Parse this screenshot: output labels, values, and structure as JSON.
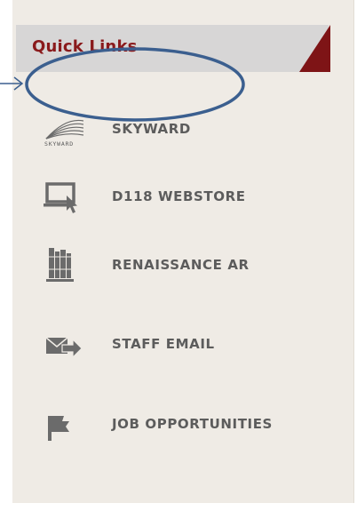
{
  "quick_links": {
    "title": "Quick Links",
    "accent_color": "#7e1416",
    "items": [
      {
        "label": "SKYWARD",
        "icon": "skyward-logo-icon",
        "logo_text": "SKYWARD"
      },
      {
        "label": "D118 WEBSTORE",
        "icon": "computer-cursor-icon"
      },
      {
        "label": "RENAISSANCE AR",
        "icon": "books-icon"
      },
      {
        "label": "STAFF EMAIL",
        "icon": "email-send-icon"
      },
      {
        "label": "JOB OPPORTUNITIES",
        "icon": "flag-icon"
      }
    ]
  },
  "annotation": {
    "shape": "ellipse-with-arrow",
    "color": "#3b5f8f"
  }
}
